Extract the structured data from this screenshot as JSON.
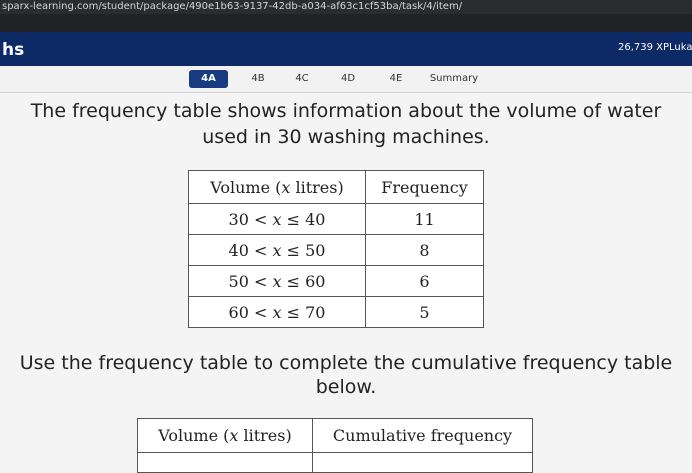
{
  "browser": {
    "url": "sparx-learning.com/student/package/490e1b63-9137-42db-a034-af63c1cf53ba/task/4/item/"
  },
  "header": {
    "brand": "hs",
    "xp": "26,739 XP",
    "user": "Luka"
  },
  "tabs": [
    {
      "label": "4A",
      "active": true
    },
    {
      "label": "4B",
      "active": false
    },
    {
      "label": "4C",
      "active": false
    },
    {
      "label": "4D",
      "active": false
    },
    {
      "label": "4E",
      "active": false
    },
    {
      "label": "Summary",
      "active": false
    }
  ],
  "question": {
    "line1": "The frequency table shows information about the volume of water",
    "line2": "used in 30 washing machines.",
    "instruction1": "Use the frequency table to complete the cumulative frequency table",
    "instruction2": "below."
  },
  "frequency_table": {
    "headers": [
      "Volume (x litres)",
      "Frequency"
    ],
    "rows": [
      {
        "low": "30",
        "high": "40",
        "frequency": "11"
      },
      {
        "low": "40",
        "high": "50",
        "frequency": "8"
      },
      {
        "low": "50",
        "high": "60",
        "frequency": "6"
      },
      {
        "low": "60",
        "high": "70",
        "frequency": "5"
      }
    ]
  },
  "cumulative_table": {
    "headers": [
      "Volume (x litres)",
      "Cumulative frequency"
    ]
  },
  "colors": {
    "header_bg": "#0d2a66",
    "active_tab": "#173a80"
  }
}
